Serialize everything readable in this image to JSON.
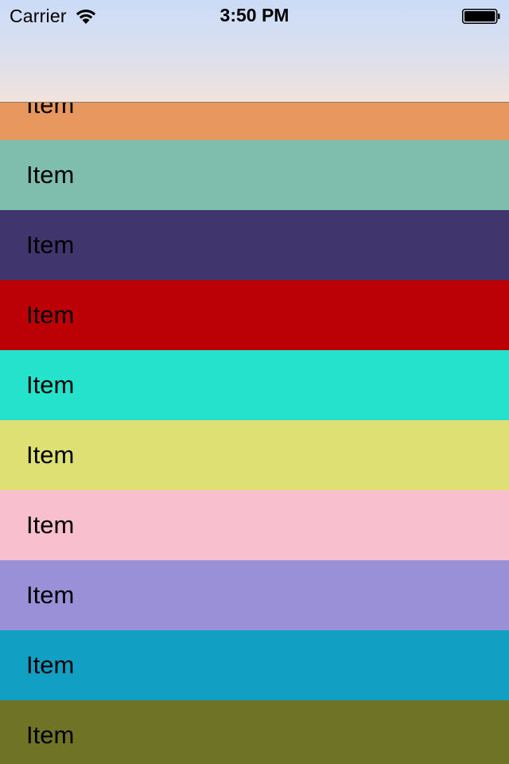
{
  "status_bar": {
    "carrier": "Carrier",
    "time": "3:50 PM",
    "wifi_icon": "wifi-icon",
    "battery_icon": "battery-icon"
  },
  "list": {
    "items": [
      {
        "label": "Item",
        "color": "#e8975e"
      },
      {
        "label": "Item",
        "color": "#7fbeac"
      },
      {
        "label": "Item",
        "color": "#40366d"
      },
      {
        "label": "Item",
        "color": "#bb0006"
      },
      {
        "label": "Item",
        "color": "#24e2cc"
      },
      {
        "label": "Item",
        "color": "#dfe073"
      },
      {
        "label": "Item",
        "color": "#f8c0cf"
      },
      {
        "label": "Item",
        "color": "#9990d8"
      },
      {
        "label": "Item",
        "color": "#119fc4"
      },
      {
        "label": "Item",
        "color": "#6e7325"
      }
    ]
  }
}
